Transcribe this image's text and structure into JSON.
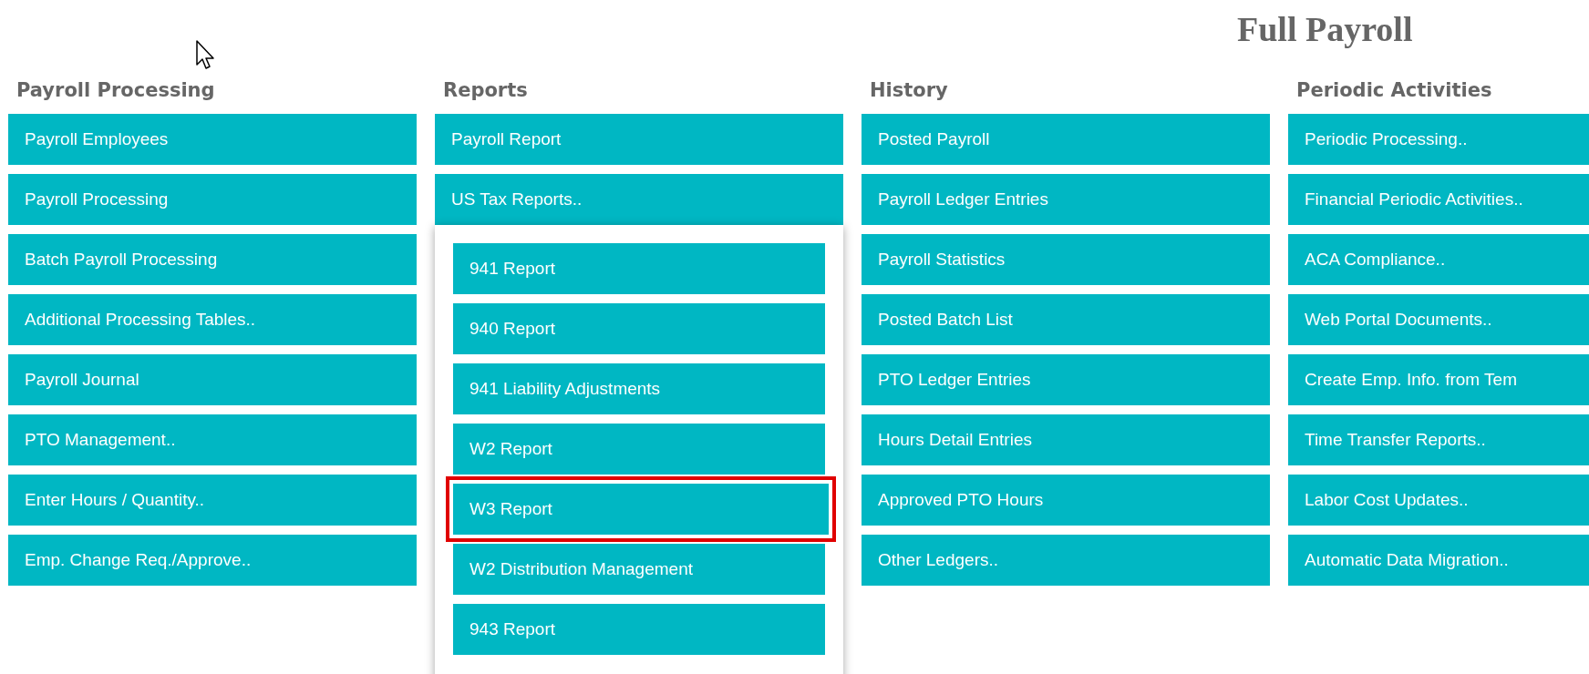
{
  "title": "Full Payroll",
  "columns": [
    {
      "heading": "Payroll Processing",
      "items": [
        {
          "label": "Payroll Employees"
        },
        {
          "label": "Payroll Processing"
        },
        {
          "label": "Batch Payroll Processing"
        },
        {
          "label": "Additional Processing Tables.."
        },
        {
          "label": "Payroll Journal"
        },
        {
          "label": "PTO Management.."
        },
        {
          "label": "Enter Hours / Quantity.."
        },
        {
          "label": "Emp. Change Req./Approve.."
        }
      ]
    },
    {
      "heading": "Reports",
      "items": [
        {
          "label": "Payroll Report"
        },
        {
          "label": "US Tax Reports..",
          "expanded": true,
          "children": [
            {
              "label": "941 Report",
              "highlighted": false
            },
            {
              "label": "940 Report",
              "highlighted": false
            },
            {
              "label": "941 Liability Adjustments",
              "highlighted": false
            },
            {
              "label": "W2 Report",
              "highlighted": false
            },
            {
              "label": "W3 Report",
              "highlighted": true
            },
            {
              "label": "W2 Distribution Management",
              "highlighted": false
            },
            {
              "label": "943 Report",
              "highlighted": false
            }
          ]
        }
      ]
    },
    {
      "heading": "History",
      "items": [
        {
          "label": "Posted Payroll"
        },
        {
          "label": "Payroll Ledger Entries"
        },
        {
          "label": "Payroll Statistics"
        },
        {
          "label": "Posted Batch List"
        },
        {
          "label": "PTO Ledger Entries"
        },
        {
          "label": "Hours Detail Entries"
        },
        {
          "label": "Approved PTO Hours"
        },
        {
          "label": "Other Ledgers.."
        }
      ]
    },
    {
      "heading": "Periodic Activities",
      "items": [
        {
          "label": "Periodic Processing.."
        },
        {
          "label": "Financial Periodic Activities.."
        },
        {
          "label": "ACA Compliance.."
        },
        {
          "label": "Web Portal Documents.."
        },
        {
          "label": "Create Emp. Info. from Tem"
        },
        {
          "label": "Time Transfer Reports.."
        },
        {
          "label": "Labor Cost Updates.."
        },
        {
          "label": "Automatic Data Migration.."
        }
      ]
    }
  ]
}
